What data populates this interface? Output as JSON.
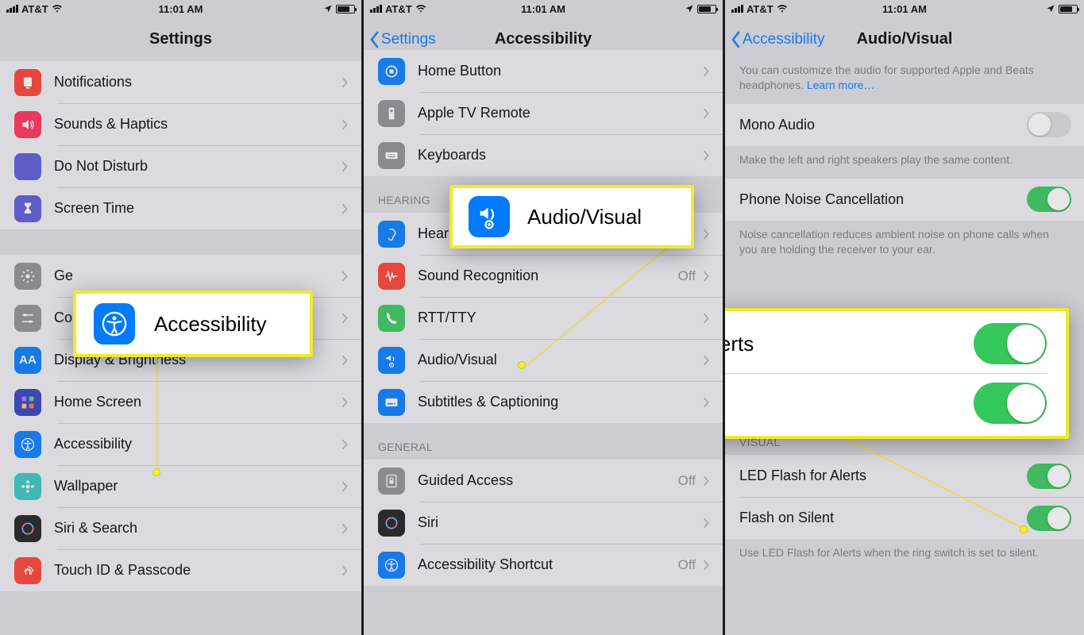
{
  "status": {
    "carrier": "AT&T",
    "time": "11:01 AM"
  },
  "screen1": {
    "title": "Settings",
    "rows_a": [
      {
        "label": "Notifications",
        "color": "#ff3b30",
        "icon": "bell"
      },
      {
        "label": "Sounds & Haptics",
        "color": "#ff2d55",
        "icon": "speaker"
      },
      {
        "label": "Do Not Disturb",
        "color": "#5856d6",
        "icon": "moon"
      },
      {
        "label": "Screen Time",
        "color": "#5856d6",
        "icon": "hourglass"
      }
    ],
    "rows_b": [
      {
        "label": "General",
        "color": "#8e8e93",
        "icon": "gear",
        "clip": "Ge"
      },
      {
        "label": "Control Center",
        "color": "#8e8e93",
        "icon": "sliders",
        "clip": "Co"
      },
      {
        "label": "Display & Brightness",
        "color": "#007aff",
        "icon": "aa"
      },
      {
        "label": "Home Screen",
        "color": "#2f3cc0",
        "icon": "grid"
      },
      {
        "label": "Accessibility",
        "color": "#007aff",
        "icon": "access"
      },
      {
        "label": "Wallpaper",
        "color": "#34c6c2",
        "icon": "flower"
      },
      {
        "label": "Siri & Search",
        "color": "#1a1a1c",
        "icon": "siri"
      },
      {
        "label": "Touch ID & Passcode",
        "color": "#ff3b30",
        "icon": "finger"
      }
    ],
    "callout_label": "Accessibility"
  },
  "screen2": {
    "back": "Settings",
    "title": "Accessibility",
    "rows_top": [
      {
        "label": "Home Button",
        "color": "#007aff",
        "icon": "home"
      },
      {
        "label": "Apple TV Remote",
        "color": "#8e8e93",
        "icon": "remote"
      },
      {
        "label": "Keyboards",
        "color": "#8e8e93",
        "icon": "keyboard"
      }
    ],
    "hearing_header": "HEARING",
    "rows_hearing": [
      {
        "label": "Hearing Devices",
        "color": "#007aff",
        "icon": "ear"
      },
      {
        "label": "Sound Recognition",
        "color": "#ff3b30",
        "icon": "wave",
        "detail": "Off"
      },
      {
        "label": "RTT/TTY",
        "color": "#34c759",
        "icon": "phone"
      },
      {
        "label": "Audio/Visual",
        "color": "#007aff",
        "icon": "av"
      },
      {
        "label": "Subtitles & Captioning",
        "color": "#007aff",
        "icon": "cc"
      }
    ],
    "general_header": "GENERAL",
    "rows_general": [
      {
        "label": "Guided Access",
        "color": "#8e8e93",
        "icon": "lock",
        "detail": "Off"
      },
      {
        "label": "Siri",
        "color": "#1a1a1c",
        "icon": "siri"
      },
      {
        "label": "Accessibility Shortcut",
        "color": "#007aff",
        "icon": "access",
        "detail": "Off"
      }
    ],
    "callout_label": "Audio/Visual"
  },
  "screen3": {
    "back": "Accessibility",
    "title": "Audio/Visual",
    "top_note": "You can customize the audio for supported Apple and Beats headphones.",
    "top_note_link": "Learn more…",
    "rows_audio": [
      {
        "label": "Mono Audio",
        "on": false
      }
    ],
    "mono_note": "Make the left and right speakers play the same content.",
    "rows_noise": [
      {
        "label": "Phone Noise Cancellation",
        "on": true
      }
    ],
    "noise_note": "Noise cancellation reduces ambient noise on phone calls when you are holding the receiver to your ear.",
    "visual_header": "VISUAL",
    "rows_visual": [
      {
        "label": "LED Flash for Alerts",
        "on": true
      },
      {
        "label": "Flash on Silent",
        "on": true
      }
    ],
    "visual_note": "Use LED Flash for Alerts when the ring switch is set to silent.",
    "callout_rows": [
      {
        "label": "LED Flash for Alerts",
        "on": true
      },
      {
        "label": "Flash on Silent",
        "on": true
      }
    ]
  }
}
